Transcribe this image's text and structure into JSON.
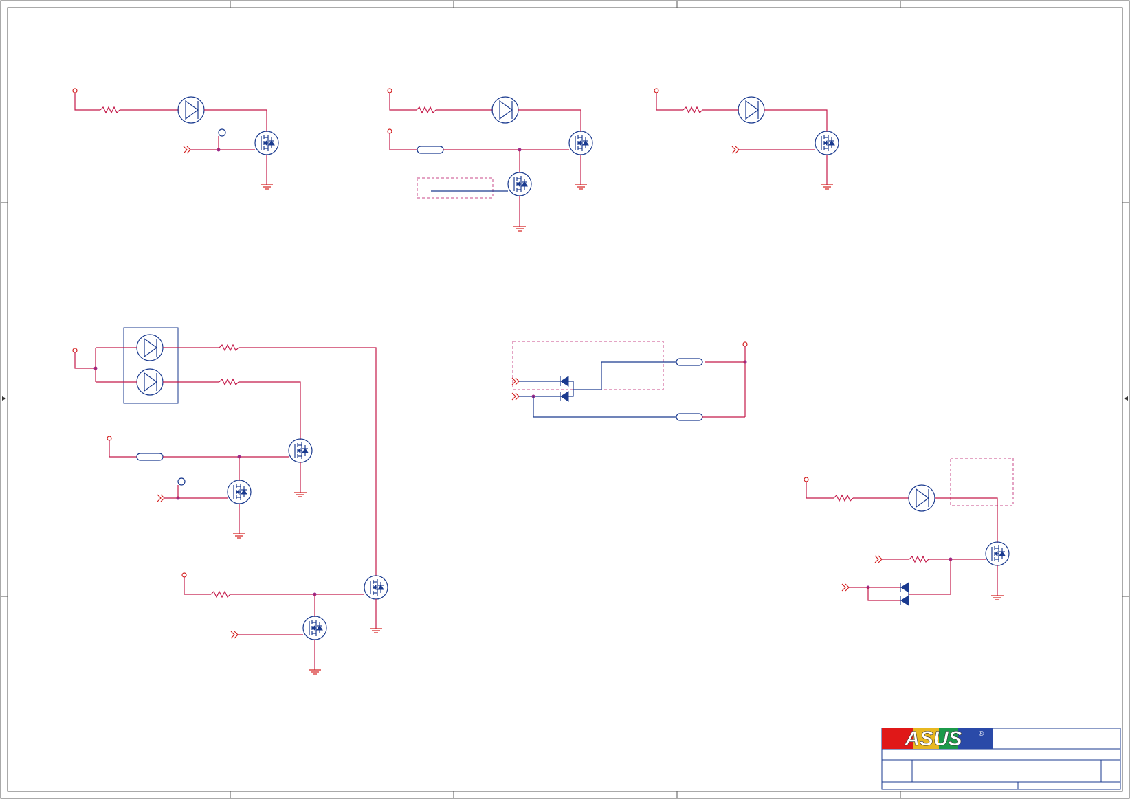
{
  "titleblock": {
    "logo_text": "ASUS",
    "registered_mark": "®",
    "colors": {
      "brand_red": "#e01818",
      "brand_blue": "#2a4aa8",
      "wire": "#c41a4a",
      "symbol": "#1a3a8f"
    }
  },
  "icons": [
    "resistor-icon",
    "led-icon",
    "mosfet-icon",
    "ground-icon",
    "power-pin-icon",
    "net-port-icon",
    "diode-icon"
  ]
}
